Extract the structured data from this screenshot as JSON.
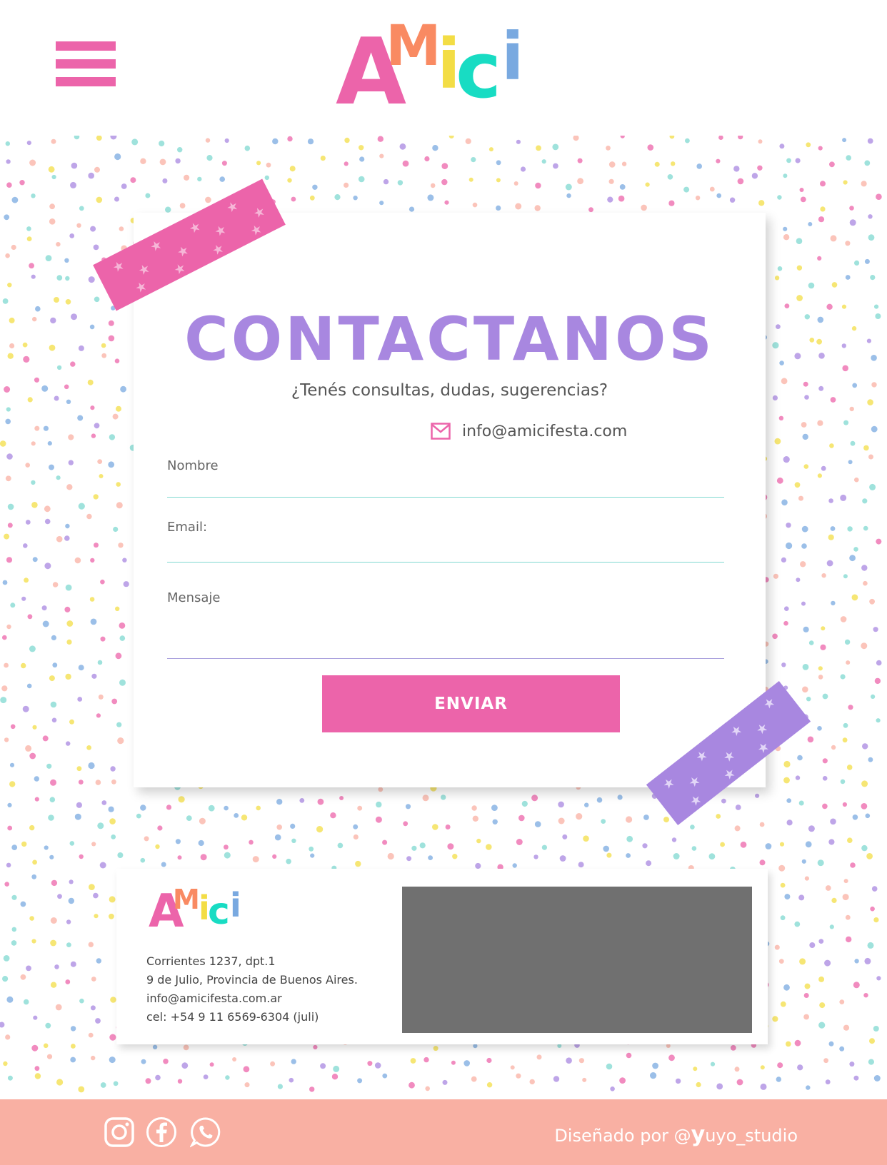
{
  "header": {
    "menu_icon": "hamburger-menu-icon",
    "logo_letters": [
      "A",
      "M",
      "i",
      "c",
      "i"
    ]
  },
  "contact": {
    "title": "CONTACTANOS",
    "subtitle": "¿Tenés consultas, dudas, sugerencias?",
    "email_icon": "mail-icon",
    "email": "info@amicifesta.com",
    "fields": {
      "name_label": "Nombre",
      "email_label": "Email:",
      "message_label": "Mensaje"
    },
    "send_label": "ENVIAR"
  },
  "footer": {
    "address_lines": [
      "Corrientes 1237, dpt.1",
      "9 de Julio, Provincia de Buenos Aires.",
      "info@amicifesta.com.ar",
      "cel: +54 9 11 6569-6304 (juli)"
    ]
  },
  "bottom_bar": {
    "social_icons": [
      "instagram-icon",
      "facebook-icon",
      "whatsapp-icon"
    ],
    "credit_prefix": "Diseñado por @",
    "credit_letter": "y",
    "credit_suffix": "uyo_studio"
  },
  "colors": {
    "pink": "#ec64aa",
    "purple": "#a887e0",
    "teal": "#7fd8d0",
    "orange": "#f9b0a3",
    "yellow": "#f3dd45",
    "blue": "#79a9e0",
    "map_gray": "#707070"
  }
}
